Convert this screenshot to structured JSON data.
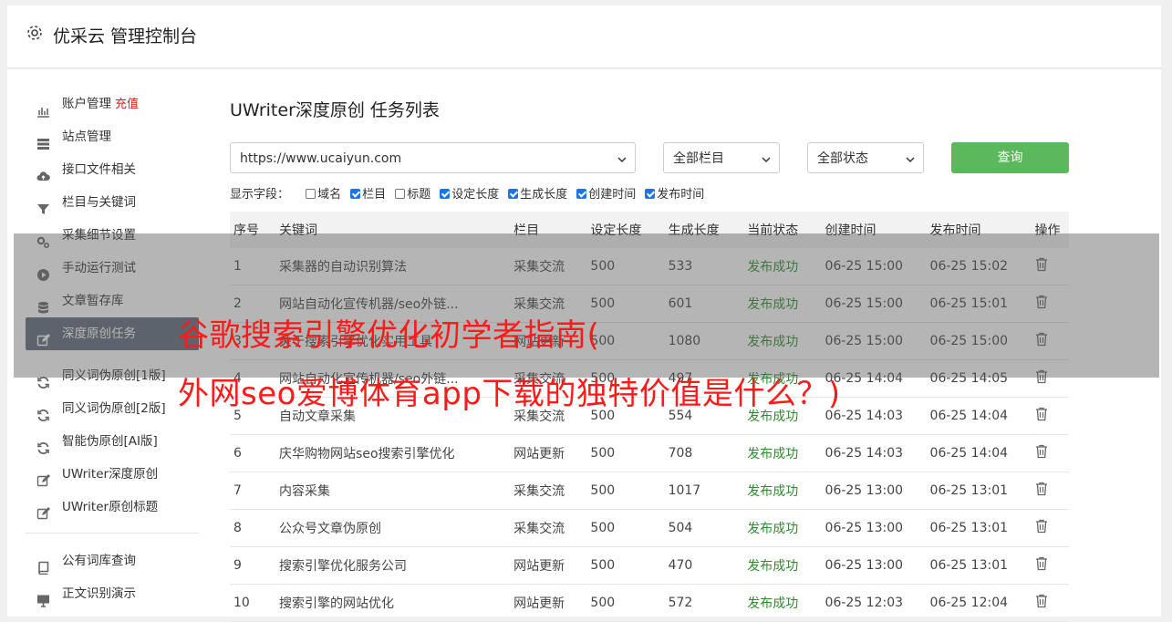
{
  "app": {
    "title": "优采云 管理控制台"
  },
  "sidebar": {
    "items": [
      {
        "label": "账户管理",
        "badge": "充值",
        "icon": "bar-chart-icon"
      },
      {
        "label": "站点管理",
        "icon": "server-icon"
      },
      {
        "label": "接口文件相关",
        "icon": "cloud-upload-icon"
      },
      {
        "label": "栏目与关键词",
        "icon": "filter-icon"
      },
      {
        "label": "采集细节设置",
        "icon": "gears-icon"
      },
      {
        "label": "手动运行测试",
        "icon": "play-circle-icon"
      },
      {
        "label": "文章暂存库",
        "icon": "database-icon"
      },
      {
        "label": "深度原创任务",
        "icon": "edit-icon",
        "active": true
      }
    ],
    "items2": [
      {
        "label": "同义词伪原创[1版]",
        "icon": "refresh-icon"
      },
      {
        "label": "同义词伪原创[2版]",
        "icon": "refresh-icon"
      },
      {
        "label": "智能伪原创[AI版]",
        "icon": "refresh-icon"
      },
      {
        "label": "UWriter深度原创",
        "icon": "edit-icon"
      },
      {
        "label": "UWriter原创标题",
        "icon": "edit-icon"
      }
    ],
    "items3": [
      {
        "label": "公有词库查询",
        "icon": "book-icon"
      },
      {
        "label": "正文识别演示",
        "icon": "monitor-icon"
      }
    ]
  },
  "main": {
    "title": "UWriter深度原创 任务列表",
    "site_select": "https://www.ucaiyun.com",
    "column_select": "全部栏目",
    "status_select": "全部状态",
    "query_label": "查询",
    "fields_label": "显示字段：",
    "fields": [
      {
        "label": "域名",
        "checked": false
      },
      {
        "label": "栏目",
        "checked": true
      },
      {
        "label": "标题",
        "checked": false
      },
      {
        "label": "设定长度",
        "checked": true
      },
      {
        "label": "生成长度",
        "checked": true
      },
      {
        "label": "创建时间",
        "checked": true
      },
      {
        "label": "发布时间",
        "checked": true
      }
    ],
    "table": {
      "headers": [
        "序号",
        "关键词",
        "栏目",
        "设定长度",
        "生成长度",
        "当前状态",
        "创建时间",
        "发布时间",
        "操作"
      ],
      "rows": [
        [
          "1",
          "采集器的自动识别算法",
          "采集交流",
          "500",
          "533",
          "发布成功",
          "06-25 15:00",
          "06-25 15:02"
        ],
        [
          "2",
          "网站自动化宣传机器/seo外链...",
          "采集交流",
          "500",
          "601",
          "发布成功",
          "06-25 15:00",
          "06-25 15:01"
        ],
        [
          "3",
          "关于搜索引擎优化实用工具",
          "网站更新",
          "500",
          "1080",
          "发布成功",
          "06-25 15:00",
          "06-25 15:00"
        ],
        [
          "4",
          "网站自动化宣传机器/seo外链...",
          "采集交流",
          "500",
          "497",
          "发布成功",
          "06-25 14:04",
          "06-25 14:05"
        ],
        [
          "5",
          "自动文章采集",
          "采集交流",
          "500",
          "554",
          "发布成功",
          "06-25 14:03",
          "06-25 14:04"
        ],
        [
          "6",
          "庆华购物网站seo搜索引擎优化",
          "网站更新",
          "500",
          "708",
          "发布成功",
          "06-25 14:03",
          "06-25 14:04"
        ],
        [
          "7",
          "内容采集",
          "采集交流",
          "500",
          "1017",
          "发布成功",
          "06-25 13:00",
          "06-25 13:01"
        ],
        [
          "8",
          "公众号文章伪原创",
          "采集交流",
          "500",
          "504",
          "发布成功",
          "06-25 13:00",
          "06-25 13:01"
        ],
        [
          "9",
          "搜索引擎优化服务公司",
          "网站更新",
          "500",
          "470",
          "发布成功",
          "06-25 13:00",
          "06-25 13:01"
        ],
        [
          "10",
          "搜索引擎的网站优化",
          "网站更新",
          "500",
          "572",
          "发布成功",
          "06-25 12:03",
          "06-25 12:04"
        ]
      ],
      "row_action_icon": "trash-icon"
    }
  },
  "overlay": {
    "line1": "谷歌搜索引擎优化初学者指南(",
    "line2": "外网seo爱博体育app下载的独特价值是什么？)",
    "color": "#ff1a1a"
  }
}
